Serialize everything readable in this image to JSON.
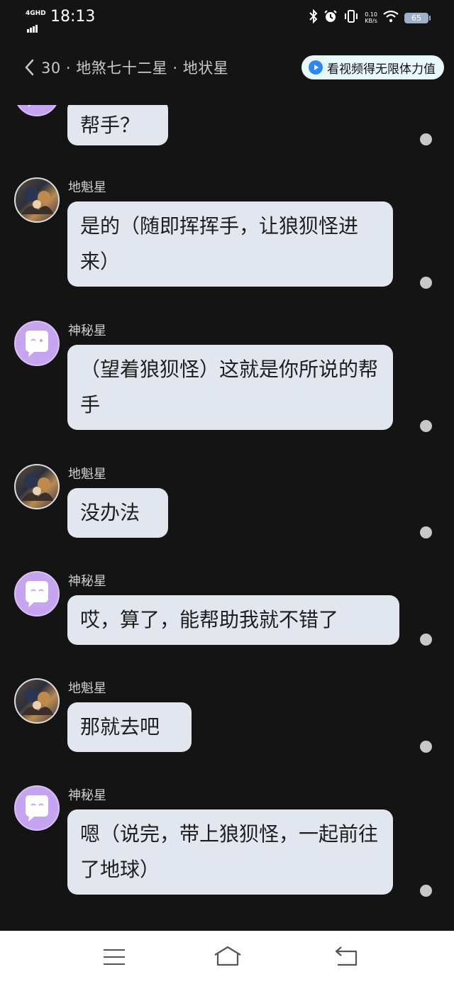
{
  "status_bar": {
    "network": "4GHD",
    "time": "18:13",
    "speed_value": "0.10",
    "speed_unit": "KB/s",
    "battery": "65"
  },
  "header": {
    "title": "30 · 地煞七十二星 · 地状星",
    "promo_label": "看视频得无限体力值"
  },
  "messages": [
    {
      "sender": "",
      "text": "帮手？",
      "avatar": "mysterious-avatar"
    },
    {
      "sender": "地魁星",
      "text": "是的（随即挥挥手，让狼狈怪进来）",
      "avatar": "dikuixing-avatar"
    },
    {
      "sender": "神秘星",
      "text": "（望着狼狈怪）这就是你所说的帮手",
      "avatar": "mysterious-avatar"
    },
    {
      "sender": "地魁星",
      "text": "没办法",
      "avatar": "dikuixing-avatar"
    },
    {
      "sender": "神秘星",
      "text": "哎，算了，能帮助我就不错了",
      "avatar": "mysterious-avatar"
    },
    {
      "sender": "地魁星",
      "text": "那就去吧",
      "avatar": "dikuixing-avatar"
    },
    {
      "sender": "神秘星",
      "text": "嗯（说完，带上狼狈怪，一起前往了地球）",
      "avatar": "mysterious-avatar"
    }
  ],
  "colors": {
    "background": "#141414",
    "bubble": "#e2e6ee",
    "mysterious_avatar": "#c7a4ef",
    "promo_bg": "#e7f8fb",
    "promo_icon": "#2f86f0"
  }
}
